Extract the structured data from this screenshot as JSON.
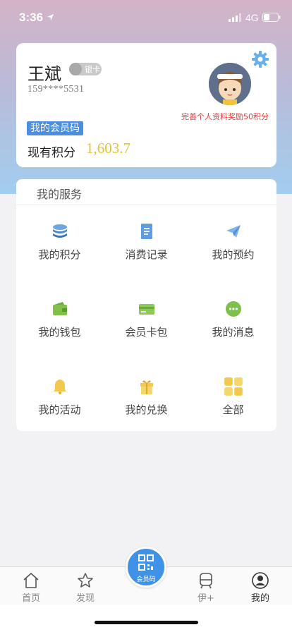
{
  "status_bar": {
    "time": "3:36",
    "network": "4G"
  },
  "profile": {
    "name": "王斌",
    "badge": "银卡",
    "phone": "159****5531",
    "reward_hint": "完善个人资料奖励50积分",
    "member_code_tag": "我的会员码",
    "points_label": "现有积分",
    "points_value": "1,603.7"
  },
  "services": {
    "title": "我的服务",
    "items": [
      {
        "label": "我的积分",
        "icon": "coin-stack-icon"
      },
      {
        "label": "消费记录",
        "icon": "receipt-icon"
      },
      {
        "label": "我的预约",
        "icon": "paper-plane-icon"
      },
      {
        "label": "我的钱包",
        "icon": "wallet-icon"
      },
      {
        "label": "会员卡包",
        "icon": "card-icon"
      },
      {
        "label": "我的消息",
        "icon": "chat-bubble-icon"
      },
      {
        "label": "我的活动",
        "icon": "bell-icon"
      },
      {
        "label": "我的兑换",
        "icon": "gift-icon"
      },
      {
        "label": "全部",
        "icon": "grid-icon"
      }
    ]
  },
  "tabbar": {
    "tabs": [
      {
        "label": "首页",
        "icon": "home-icon"
      },
      {
        "label": "发现",
        "icon": "star-icon"
      },
      {
        "label": "伊+",
        "icon": "train-icon"
      },
      {
        "label": "我的",
        "icon": "user-icon"
      }
    ],
    "center_button_label": "会员码"
  },
  "colors": {
    "accent": "#3f92e6",
    "points": "#e5c233",
    "reward": "#e03a3a"
  }
}
